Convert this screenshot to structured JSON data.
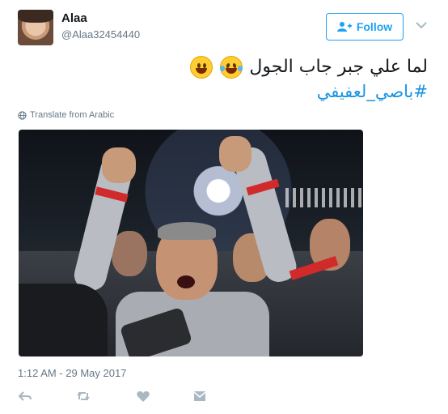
{
  "user": {
    "name": "Alaa",
    "handle": "@Alaa32454440"
  },
  "header": {
    "follow_label": "Follow"
  },
  "tweet": {
    "text": "لما علي جبر جاب الجول",
    "hashtag": "#باصي_لعفيفي",
    "emojis": [
      "face-with-tears-of-joy",
      "grinning-face"
    ],
    "translate_label": "Translate from Arabic",
    "timestamp": "1:12 AM - 29 May 2017"
  },
  "actions": {
    "icons": [
      "reply-icon",
      "retweet-icon",
      "like-icon",
      "message-icon"
    ]
  },
  "colors": {
    "brand_blue": "#1da1f2",
    "link_blue": "#1b95e0",
    "muted_gray": "#657786",
    "text": "#14171a"
  }
}
